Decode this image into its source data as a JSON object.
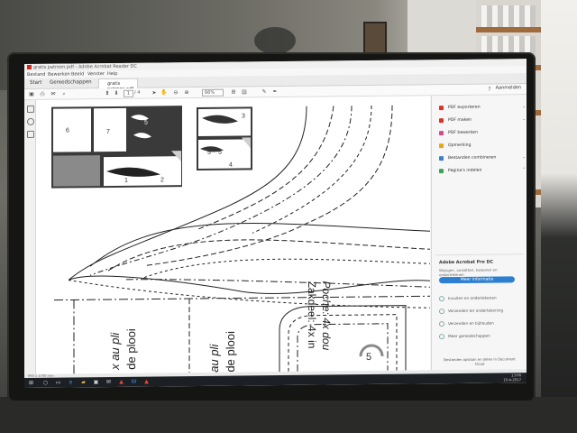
{
  "window_title": "gratis patroon.pdf - Adobe Acrobat Reader DC",
  "menu": [
    "Bestand",
    "Bewerken",
    "Beeld",
    "Venster",
    "Help"
  ],
  "tabs": {
    "start": "Start",
    "tools": "Gereedschappen",
    "document": "gratis patroon.pdf"
  },
  "toolbar": {
    "page_current": "1",
    "page_total": "/ 4",
    "zoom": "66%",
    "comment": "Aanmelden"
  },
  "pattern": {
    "thumb_numbers_left": [
      "6",
      "7",
      "5",
      "1",
      "2"
    ],
    "thumb_numbers_right": [
      "3",
      "5",
      "5",
      "4"
    ],
    "piece_number": "5",
    "labels": [
      "x au pli",
      "de plooi",
      "au pli",
      "de plooi",
      "Poche: 4x dou",
      "Zakdeel: 4x in"
    ]
  },
  "right_panel": {
    "tools": [
      {
        "label": "PDF exporteren",
        "color": "#d8332a"
      },
      {
        "label": "PDF maken",
        "color": "#d8332a"
      },
      {
        "label": "PDF bewerken",
        "color": "#d54a8f"
      },
      {
        "label": "Opmerking",
        "color": "#e6a619"
      },
      {
        "label": "Bestanden combineren",
        "color": "#3e7fcb"
      },
      {
        "label": "Pagina's indelen",
        "color": "#3aa35a"
      }
    ],
    "pro_title": "Adobe Acrobat Pro DC",
    "pro_subtitle": "Wijzigen, omzetten, bewaren en ondertekenen",
    "pro_button": "Meer informatie",
    "extras": [
      "Invullen en ondertekenen",
      "Verzenden ter ondertekening",
      "Verzenden en bijhouden",
      "Meer gereedschappen"
    ],
    "footer": "Bestanden opslaan en delen in Document Cloud"
  },
  "statusbar": "990 x 1700 mm",
  "taskbar": {
    "time": "13:06",
    "date": "15-4-2017"
  }
}
